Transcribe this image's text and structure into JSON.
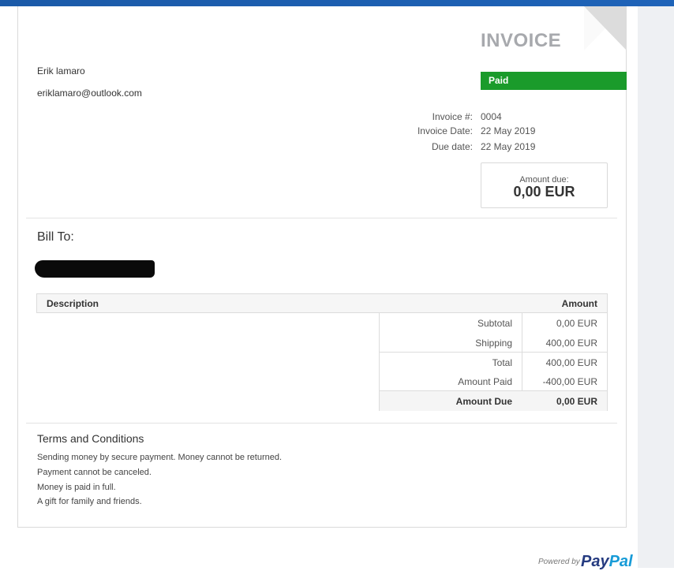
{
  "sender": {
    "name": "Erik lamaro",
    "email": "eriklamaro@outlook.com"
  },
  "invoice": {
    "title": "INVOICE",
    "status": "Paid",
    "meta": [
      {
        "label": "Invoice #:",
        "value": "0004"
      },
      {
        "label": "Invoice Date:",
        "value": "22 May 2019"
      },
      {
        "label": "Due date:",
        "value": "22 May 2019"
      }
    ],
    "amount_due_label": "Amount due:",
    "amount_due_value": "0,00 EUR"
  },
  "bill_to": {
    "heading": "Bill To:"
  },
  "table": {
    "headers": {
      "description": "Description",
      "amount": "Amount"
    },
    "totals": [
      {
        "label": "Subtotal",
        "value": "0,00 EUR"
      },
      {
        "label": "Shipping",
        "value": "400,00 EUR"
      },
      {
        "label": "Total",
        "value": "400,00 EUR"
      },
      {
        "label": "Amount Paid",
        "value": "-400,00 EUR"
      },
      {
        "label": "Amount Due",
        "value": "0,00 EUR"
      }
    ]
  },
  "terms": {
    "title": "Terms and Conditions",
    "lines": [
      "Sending money by secure payment. Money cannot be returned.",
      "Payment cannot be canceled.",
      "Money is paid in full.",
      "A gift for family and friends."
    ]
  },
  "footer": {
    "powered_by": "Powered by",
    "brand_pay": "Pay",
    "brand_pal": "Pal"
  },
  "colors": {
    "paid_green": "#1a9b2b",
    "header_blue": "#1b5aa8",
    "paypal_dark": "#253b80",
    "paypal_light": "#179bd7"
  }
}
